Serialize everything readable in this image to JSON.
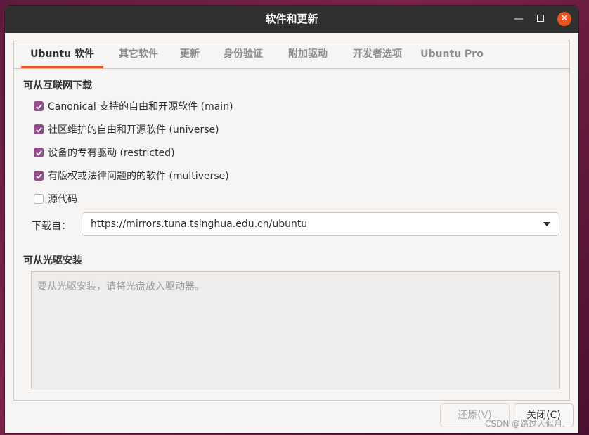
{
  "window": {
    "title": "软件和更新"
  },
  "tabs": [
    {
      "label": "Ubuntu 软件",
      "active": true
    },
    {
      "label": "其它软件",
      "active": false
    },
    {
      "label": "更新",
      "active": false
    },
    {
      "label": "身份验证",
      "active": false
    },
    {
      "label": "附加驱动",
      "active": false
    },
    {
      "label": "开发者选项",
      "active": false
    },
    {
      "label": "Ubuntu Pro",
      "active": false
    }
  ],
  "internet": {
    "title": "可从互联网下载",
    "items": [
      {
        "label": "Canonical 支持的自由和开源软件 (main)",
        "checked": true
      },
      {
        "label": "社区维护的自由和开源软件 (universe)",
        "checked": true
      },
      {
        "label": "设备的专有驱动 (restricted)",
        "checked": true
      },
      {
        "label": "有版权或法律问题的的软件 (multiverse)",
        "checked": true
      },
      {
        "label": "源代码",
        "checked": false
      }
    ],
    "download_from_label": "下载自：",
    "download_server": "https://mirrors.tuna.tsinghua.edu.cn/ubuntu"
  },
  "cdrom": {
    "title": "可从光驱安装",
    "placeholder": "要从光驱安装，请将光盘放入驱动器。"
  },
  "buttons": {
    "revert": "还原(V)",
    "close": "关闭(C)"
  },
  "watermark": "CSDN @路过人似月.",
  "colors": {
    "accent": "#e95420",
    "checkbox": "#924d8b",
    "titlebar": "#303030"
  }
}
